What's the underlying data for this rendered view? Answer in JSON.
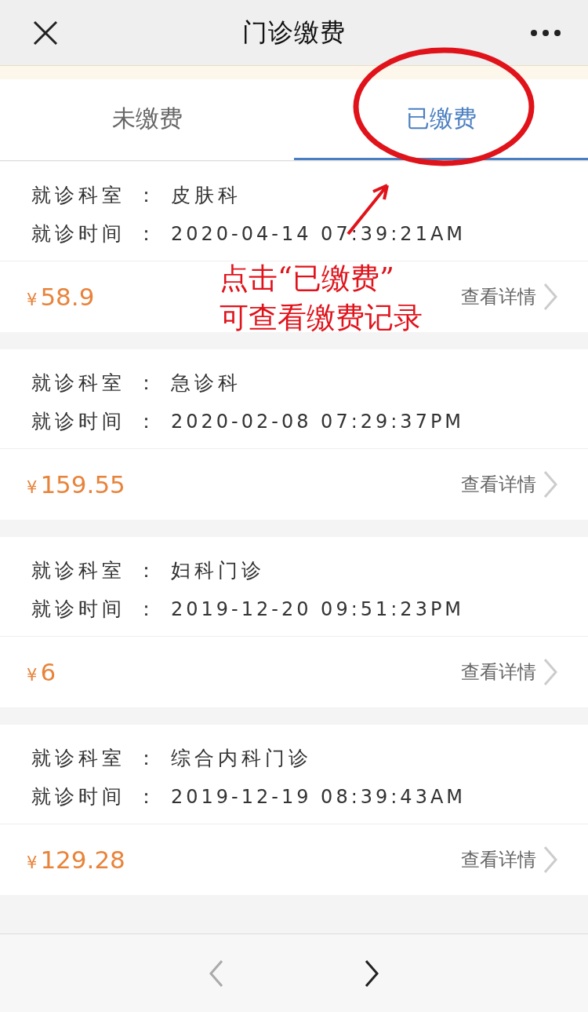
{
  "nav": {
    "title": "门诊缴费"
  },
  "tabs": [
    {
      "label": "未缴费",
      "selected": false
    },
    {
      "label": "已缴费",
      "selected": true
    }
  ],
  "records": [
    {
      "dept_label": "就诊科室",
      "sep": "：",
      "dept": "皮肤科",
      "time_label": "就诊时间",
      "time": "2020-04-14 07:39:21AM",
      "currency": "¥",
      "amount": "58.9",
      "detail": "查看详情"
    },
    {
      "dept_label": "就诊科室",
      "sep": "：",
      "dept": "急诊科",
      "time_label": "就诊时间",
      "time": "2020-02-08 07:29:37PM",
      "currency": "¥",
      "amount": "159.55",
      "detail": "查看详情"
    },
    {
      "dept_label": "就诊科室",
      "sep": "：",
      "dept": "妇科门诊",
      "time_label": "就诊时间",
      "time": "2019-12-20 09:51:23PM",
      "currency": "¥",
      "amount": "6",
      "detail": "查看详情"
    },
    {
      "dept_label": "就诊科室",
      "sep": "：",
      "dept": "综合内科门诊",
      "time_label": "就诊时间",
      "time": "2019-12-19 08:39:43AM",
      "currency": "¥",
      "amount": "129.28",
      "detail": "查看详情"
    }
  ],
  "annotation": {
    "lines": [
      "点击“已缴费”",
      "可查看缴费记录"
    ]
  },
  "toolbar": {
    "back": {
      "disabled": true
    },
    "forward": {
      "disabled": false
    }
  }
}
